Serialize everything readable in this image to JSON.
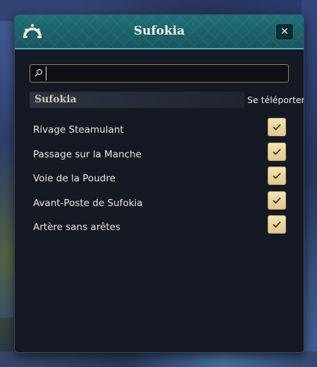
{
  "window": {
    "title": "Sufokia",
    "close_label": "✕"
  },
  "search": {
    "value": "",
    "placeholder": ""
  },
  "region": {
    "name": "Sufokia"
  },
  "list": {
    "action_header": "Se téléporter",
    "items": [
      {
        "label": "Rivage Steamulant"
      },
      {
        "label": "Passage sur la Manche"
      },
      {
        "label": "Voie de la Poudre"
      },
      {
        "label": "Avant-Poste de Sufokia"
      },
      {
        "label": "Artère sans arêtes"
      }
    ]
  },
  "icons": {
    "logo": "guild-emblem-icon",
    "search": "search-icon",
    "close": "close-icon",
    "check": "checkmark-icon"
  },
  "colors": {
    "titlebar": "#1f6f77",
    "titlebar_border": "#47b3b9",
    "panel_bg": "#141923",
    "check_button": "#f0dca8"
  }
}
